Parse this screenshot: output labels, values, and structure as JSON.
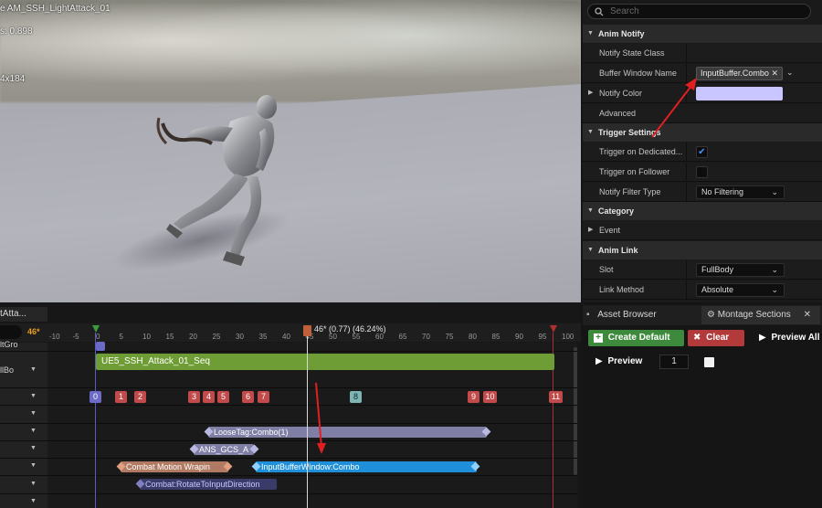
{
  "viewport": {
    "title": "e AM_SSH_LightAttack_01",
    "stat1": "s: 0.898",
    "stat2": "4x184"
  },
  "details": {
    "search_placeholder": "Search",
    "sections": {
      "anim_notify": "Anim Notify",
      "trigger_settings": "Trigger Settings",
      "category": "Category",
      "anim_link": "Anim Link"
    },
    "rows": {
      "notify_state_class": "Notify State Class",
      "buffer_window_name": "Buffer Window Name",
      "buffer_window_value": "InputBuffer.Combo",
      "notify_color": "Notify Color",
      "advanced": "Advanced",
      "trigger_dedicated": "Trigger on Dedicated...",
      "trigger_follower": "Trigger on Follower",
      "notify_filter_type": "Notify Filter Type",
      "notify_filter_value": "No Filtering",
      "event": "Event",
      "slot": "Slot",
      "slot_value": "FullBody",
      "link_method": "Link Method",
      "link_method_value": "Absolute"
    },
    "notify_color_hex": "#c9c5ff",
    "trigger_dedicated_checked": true,
    "trigger_follower_checked": false
  },
  "timeline": {
    "left_title": "tAtta...",
    "frame_counter": "46*",
    "left_labels": [
      "ltGro",
      "llBo"
    ],
    "playhead_label": "46* (0.77) (46.24%)",
    "ticks": [
      "-10",
      "-5",
      "0",
      "5",
      "10",
      "15",
      "20",
      "25",
      "30",
      "35",
      "40",
      "45",
      "50",
      "55",
      "60",
      "65",
      "70",
      "75",
      "80",
      "85",
      "90",
      "95",
      "100"
    ],
    "section_marker": "",
    "segment_label": "UE5_SSH_Attack_01_Seq",
    "markers": [
      "0",
      "1",
      "2",
      "3",
      "4",
      "5",
      "6",
      "7",
      "8",
      "9",
      "10",
      "11"
    ],
    "notifies": {
      "loose_tag": "LooseTag:Combo(1)",
      "ans_gcs": "ANS_GCS_A",
      "combat_motion": "Combat Motion Wrapin",
      "input_buffer": "InputBufferWindow:Combo",
      "rotate": "Combat:RotateToInputDirection"
    }
  },
  "bottom_right": {
    "tab_asset_browser": "Asset Browser",
    "tab_montage_sections": "Montage Sections",
    "create_default": "Create Default",
    "clear": "Clear",
    "preview_all": "Preview All",
    "preview": "Preview",
    "preview_value": "1"
  }
}
